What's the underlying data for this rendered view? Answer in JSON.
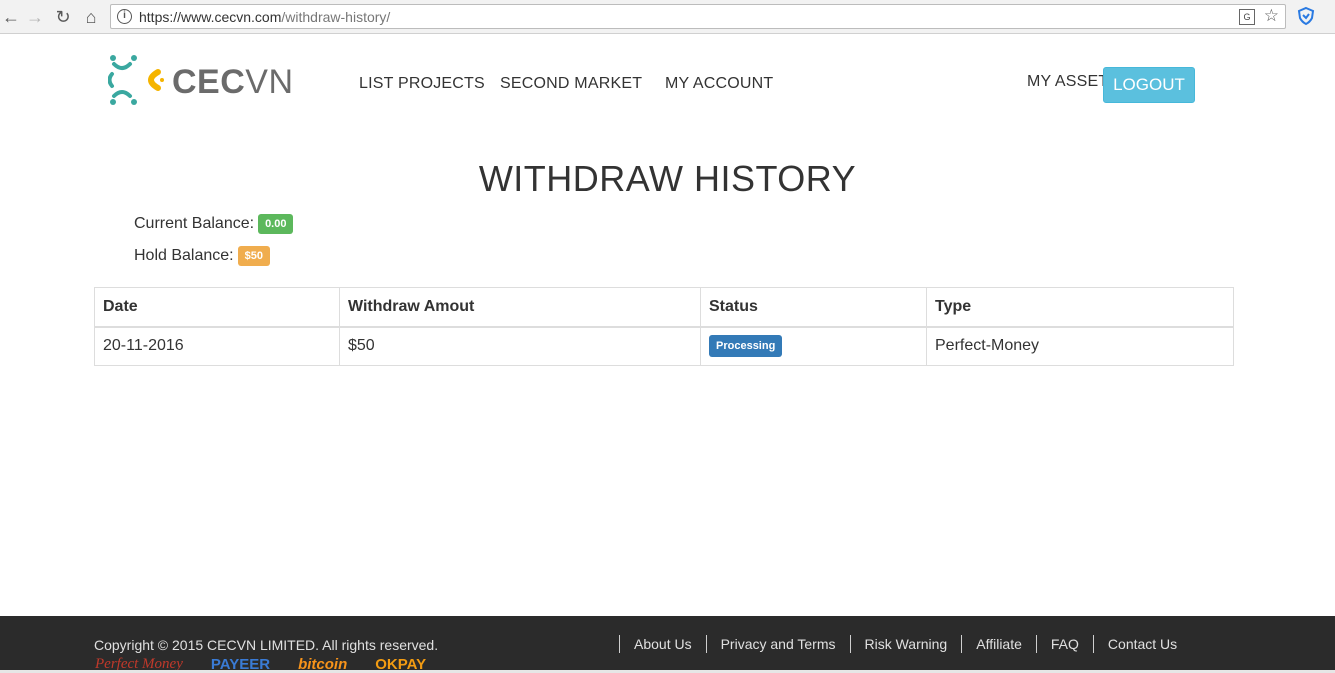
{
  "browser": {
    "url_host": "https://www.cecvn.com",
    "url_path": "/withdraw-history/"
  },
  "header": {
    "logo_part1": "CEC",
    "logo_part2": "VN",
    "nav": [
      "LIST PROJECTS",
      "SECOND MARKET",
      "MY ACCOUNT"
    ],
    "my_asset": "MY ASSET",
    "logout": "LOGOUT"
  },
  "main": {
    "title": "WITHDRAW HISTORY",
    "current_balance_label": "Current Balance:",
    "current_balance_value": "0.00",
    "hold_balance_label": "Hold Balance:",
    "hold_balance_value": "$50",
    "table": {
      "headers": [
        "Date",
        "Withdraw Amout",
        "Status",
        "Type"
      ],
      "rows": [
        {
          "date": "20-11-2016",
          "amount": "$50",
          "status": "Processing",
          "type": "Perfect-Money"
        }
      ]
    }
  },
  "footer": {
    "copyright": "Copyright © 2015 CECVN LIMITED. All rights reserved.",
    "links": [
      "About Us",
      "Privacy and Terms",
      "Risk Warning",
      "Affiliate",
      "FAQ",
      "Contact Us"
    ],
    "payments": [
      "Perfect Money",
      "PAYEER",
      "bitcoin",
      "OKPAY"
    ]
  },
  "colors": {
    "accent": "#5bc0de",
    "success": "#5cb85c",
    "warning": "#f0ad4e",
    "primary": "#337ab7",
    "footer_bg": "#2b2b2b"
  }
}
